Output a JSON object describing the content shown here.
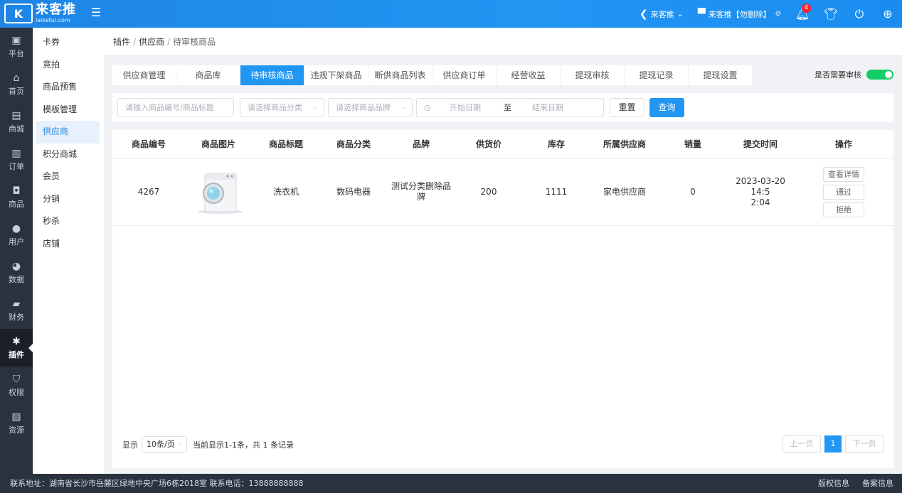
{
  "header": {
    "logo_text": "来客推",
    "logo_sub": "laiketui.com",
    "logo_mark": "K",
    "store_name": "来客推",
    "store_user": "来客推【勿删除】",
    "notification_count": "4",
    "colors": {
      "brand": "#2196f3",
      "sidebar": "#2b323f",
      "success": "#13ce66"
    }
  },
  "iconbar": [
    {
      "label": "平台",
      "icon": "platform-icon"
    },
    {
      "label": "首页",
      "icon": "home-icon"
    },
    {
      "label": "商城",
      "icon": "store-icon"
    },
    {
      "label": "订单",
      "icon": "order-icon"
    },
    {
      "label": "商品",
      "icon": "goods-icon"
    },
    {
      "label": "用户",
      "icon": "user-icon"
    },
    {
      "label": "数据",
      "icon": "data-icon"
    },
    {
      "label": "财务",
      "icon": "finance-icon"
    },
    {
      "label": "插件",
      "icon": "plugin-icon"
    },
    {
      "label": "权限",
      "icon": "permission-icon"
    },
    {
      "label": "资源",
      "icon": "resource-icon"
    }
  ],
  "subnav": [
    "卡券",
    "竞拍",
    "商品预售",
    "模板管理",
    "供应商",
    "积分商城",
    "会员",
    "分销",
    "秒杀",
    "店铺"
  ],
  "breadcrumb": {
    "l1": "插件",
    "l2": "供应商",
    "l3": "待审核商品"
  },
  "tabs": [
    "供应商管理",
    "商品库",
    "待审核商品",
    "违规下架商品",
    "断供商品列表",
    "供应商订单",
    "经营收益",
    "提现审核",
    "提现记录",
    "提现设置"
  ],
  "audit_label": "是否需要审核",
  "filters": {
    "keyword_ph": "请输入商品编号/商品标题",
    "category_ph": "请选择商品分类",
    "brand_ph": "请选择商品品牌",
    "start_ph": "开始日期",
    "to": "至",
    "end_ph": "结束日期",
    "reset": "重置",
    "query": "查询"
  },
  "table": {
    "headers": [
      "商品编号",
      "商品图片",
      "商品标题",
      "商品分类",
      "品牌",
      "供货价",
      "库存",
      "所属供应商",
      "销量",
      "提交时间",
      "操作"
    ],
    "row": {
      "id": "4267",
      "title": "洗衣机",
      "category": "数码电器",
      "brand_l1": "测试分类删除品",
      "brand_l2": "牌",
      "price": "200",
      "stock": "1111",
      "supplier": "家电供应商",
      "sales": "0",
      "time_l1": "2023-03-20 14:5",
      "time_l2": "2:04",
      "op_detail": "查看详情",
      "op_pass": "通过",
      "op_reject": "拒绝"
    }
  },
  "pager": {
    "show": "显示",
    "page_size": "10条/页",
    "summary": "当前显示1-1条，共 1 条记录",
    "prev": "上一页",
    "current": "1",
    "next": "下一页"
  },
  "footer": {
    "address": "联系地址：湖南省长沙市岳麓区绿地中央广场6栋2018室 联系电话：13888888888",
    "copyright": "版权信息",
    "record": "备案信息"
  }
}
